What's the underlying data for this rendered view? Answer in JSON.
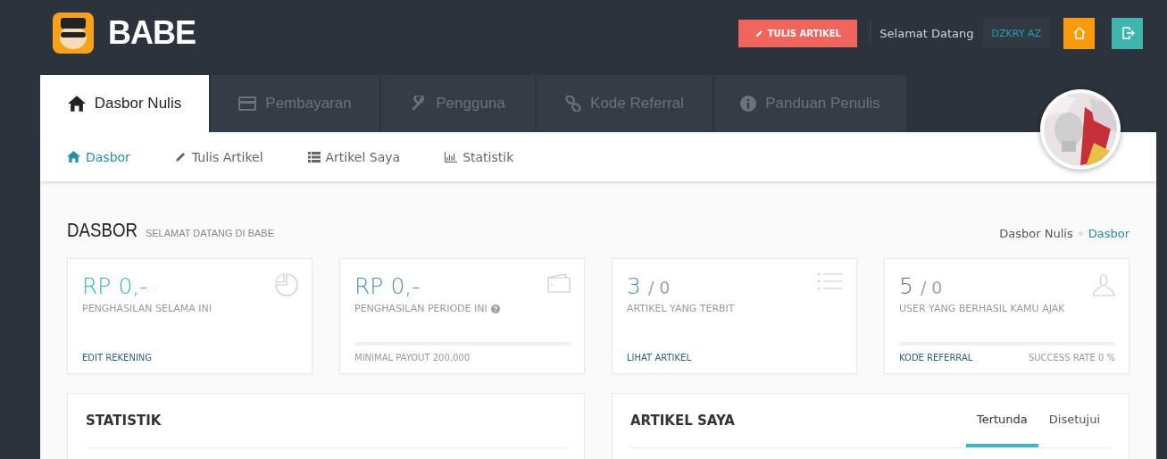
{
  "header": {
    "logo": "BABE",
    "write_button": "TULIS ARTIKEL",
    "greeting": "Selamat Datang",
    "username": "DZKRY AZ"
  },
  "tabs": [
    {
      "label": "Dasbor Nulis",
      "selected": true
    },
    {
      "label": "Pembayaran",
      "selected": false
    },
    {
      "label": "Pengguna",
      "selected": false
    },
    {
      "label": "Kode Referral",
      "selected": false
    },
    {
      "label": "Panduan Penulis",
      "selected": false
    }
  ],
  "subnav": [
    {
      "label": "Dasbor",
      "selected": true
    },
    {
      "label": "Tulis Artikel",
      "selected": false
    },
    {
      "label": "Artikel Saya",
      "selected": false
    },
    {
      "label": "Statistik",
      "selected": false
    }
  ],
  "page": {
    "title": "DASBOR",
    "subtitle": "SELAMAT DATANG DI BABE",
    "breadcrumb": [
      "Dasbor Nulis",
      "Dasbor"
    ]
  },
  "cards": [
    {
      "value": "RP 0,-",
      "label": "PENGHASILAN SELAMA INI",
      "color": "#3bb0bd",
      "help": false,
      "link": "EDIT REKENING"
    },
    {
      "value": "RP 0,-",
      "label": "PENGHASILAN PERIODE INI",
      "color": "#4f8fc0",
      "help": true,
      "level": 0,
      "note": "MINIMAL PAYOUT 200,000"
    },
    {
      "value": "3",
      "suffix": "/ 0",
      "label": "ARTIKEL YANG TERBIT",
      "color": "#4f8fc0",
      "help": false,
      "link": "LIHAT ARTIKEL"
    },
    {
      "value": "5",
      "suffix": "/ 0",
      "label": "USER YANG BERHASIL KAMU AJAK",
      "color": "#6a5e91",
      "help": false,
      "level": 0,
      "link": "KODE REFERRAL",
      "note": "SUCCESS RATE 0 %"
    }
  ],
  "panels": [
    {
      "title": "STATISTIK"
    },
    {
      "title": "ARTIKEL SAYA",
      "tabs": [
        {
          "label": "Tertunda",
          "selected": true
        },
        {
          "label": "Disetujui",
          "selected": false
        }
      ]
    }
  ]
}
